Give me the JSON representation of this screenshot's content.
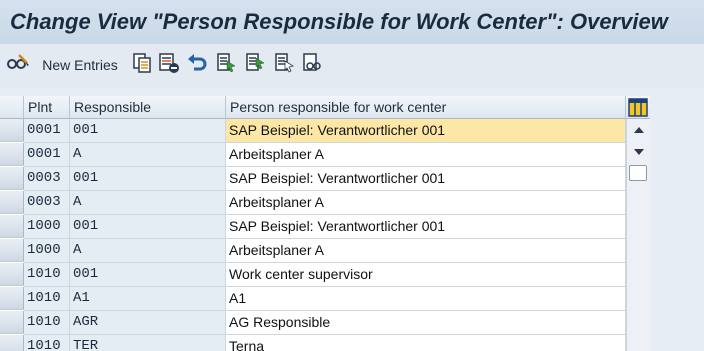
{
  "window": {
    "title": "Change View \"Person Responsible for Work Center\": Overview"
  },
  "toolbar": {
    "items": [
      {
        "icon": "glasses-pencil-icon"
      },
      {
        "label": "New Entries"
      },
      {
        "icon": "copy-icon"
      },
      {
        "icon": "delete-icon"
      },
      {
        "icon": "undo-icon"
      },
      {
        "icon": "select-all-icon"
      },
      {
        "icon": "select-block-icon"
      },
      {
        "icon": "deselect-all-icon"
      },
      {
        "icon": "print-preview-icon"
      }
    ]
  },
  "table": {
    "columns": [
      "Plnt",
      "Responsible",
      "Person responsible for work center"
    ],
    "rows": [
      {
        "plnt": "0001",
        "responsible": "001",
        "person": "SAP Beispiel: Verantwortlicher 001"
      },
      {
        "plnt": "0001",
        "responsible": "A",
        "person": "Arbeitsplaner A"
      },
      {
        "plnt": "0003",
        "responsible": "001",
        "person": "SAP Beispiel: Verantwortlicher 001"
      },
      {
        "plnt": "0003",
        "responsible": "A",
        "person": "Arbeitsplaner A"
      },
      {
        "plnt": "1000",
        "responsible": "001",
        "person": "SAP Beispiel: Verantwortlicher 001"
      },
      {
        "plnt": "1000",
        "responsible": "A",
        "person": "Arbeitsplaner A"
      },
      {
        "plnt": "1010",
        "responsible": "001",
        "person": "Work center supervisor"
      },
      {
        "plnt": "1010",
        "responsible": "A1",
        "person": "A1"
      },
      {
        "plnt": "1010",
        "responsible": "AGR",
        "person": "AG Responsible"
      },
      {
        "plnt": "1010",
        "responsible": "TER",
        "person": "Terna"
      }
    ]
  },
  "colors": {
    "active_row": "#fde7a6",
    "key_column_bg": "#e4ecf4"
  }
}
